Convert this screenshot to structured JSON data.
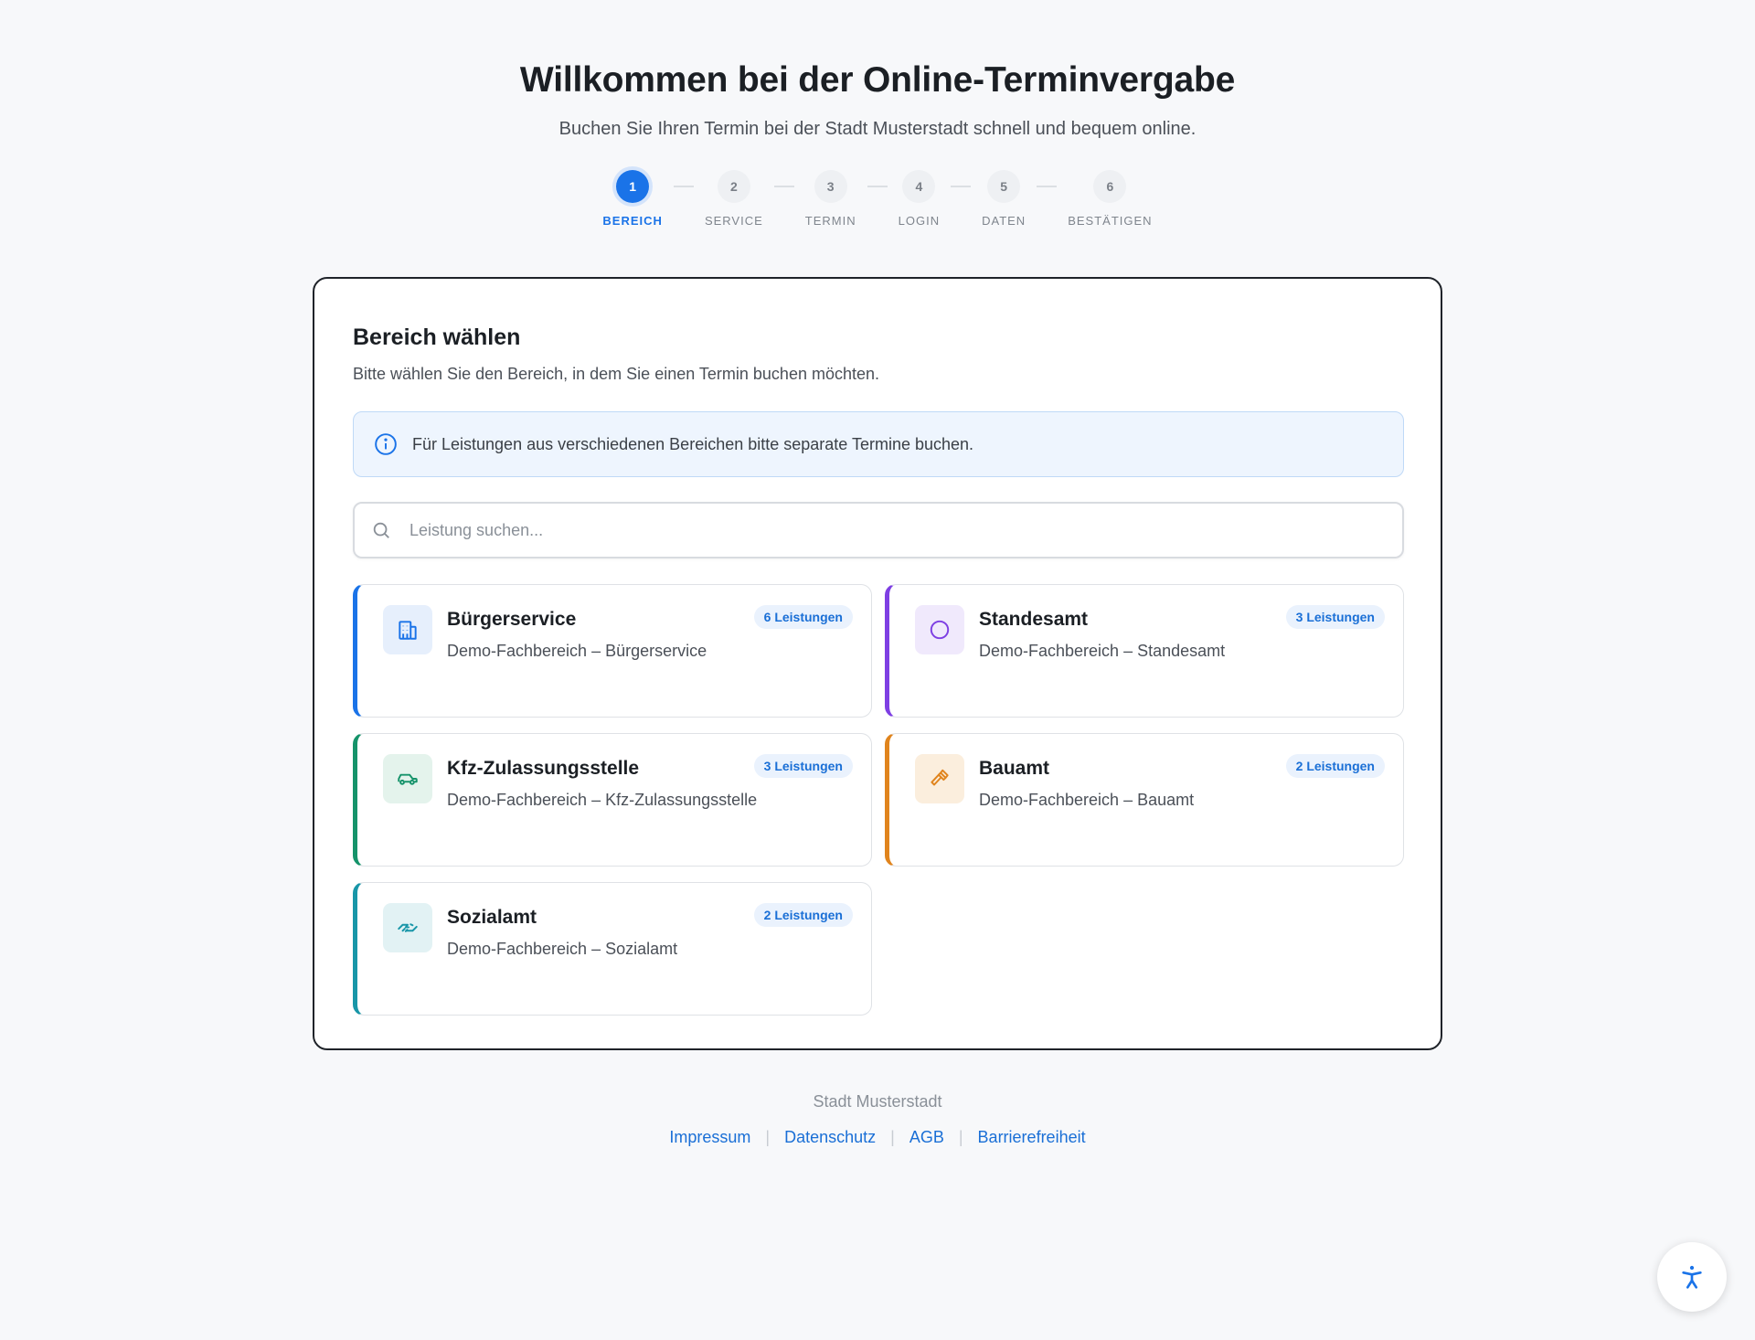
{
  "header": {
    "title": "Willkommen bei der Online-Terminvergabe",
    "subtitle": "Buchen Sie Ihren Termin bei der Stadt Musterstadt schnell und bequem online."
  },
  "stepper": {
    "active_step": 1,
    "steps": [
      {
        "number": "1",
        "label": "BEREICH"
      },
      {
        "number": "2",
        "label": "SERVICE"
      },
      {
        "number": "3",
        "label": "TERMIN"
      },
      {
        "number": "4",
        "label": "LOGIN"
      },
      {
        "number": "5",
        "label": "DATEN"
      },
      {
        "number": "6",
        "label": "BESTÄTIGEN"
      }
    ]
  },
  "main": {
    "title": "Bereich wählen",
    "description": "Bitte wählen Sie den Bereich, in dem Sie einen Termin buchen möchten.",
    "info": "Für Leistungen aus verschiedenen Bereichen bitte separate Termine buchen.",
    "search": {
      "placeholder": "Leistung suchen...",
      "value": ""
    },
    "areas": [
      {
        "name": "Bürgerservice",
        "description": "Demo-Fachbereich – Bürgerservice",
        "badge": "6 Leistungen",
        "icon": "building-icon",
        "accent": "#1a73e8",
        "icon_bg": "#e6effc"
      },
      {
        "name": "Standesamt",
        "description": "Demo-Fachbereich – Standesamt",
        "badge": "3 Leistungen",
        "icon": "ring-icon",
        "accent": "#7e3fe3",
        "icon_bg": "#f0e9fc"
      },
      {
        "name": "Kfz-Zulassungsstelle",
        "description": "Demo-Fachbereich – Kfz-Zulassungsstelle",
        "badge": "3 Leistungen",
        "icon": "car-icon",
        "accent": "#15936a",
        "icon_bg": "#e4f3ec"
      },
      {
        "name": "Bauamt",
        "description": "Demo-Fachbereich – Bauamt",
        "badge": "2 Leistungen",
        "icon": "hammer-icon",
        "accent": "#e0841d",
        "icon_bg": "#fbeedd"
      },
      {
        "name": "Sozialamt",
        "description": "Demo-Fachbereich – Sozialamt",
        "badge": "2 Leistungen",
        "icon": "handshake-icon",
        "accent": "#1896a8",
        "icon_bg": "#e2f2f4"
      }
    ]
  },
  "footer": {
    "city": "Stadt Musterstadt",
    "links": [
      "Impressum",
      "Datenschutz",
      "AGB",
      "Barrierefreiheit"
    ]
  },
  "colors": {
    "primary": "#1a73e8",
    "background": "#f7f8fa"
  },
  "accessibility_button": {
    "icon": "accessibility-icon"
  }
}
